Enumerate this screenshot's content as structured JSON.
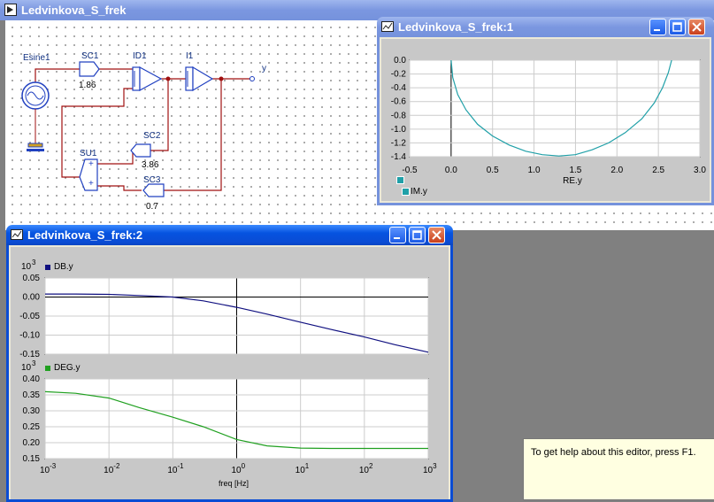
{
  "main_window": {
    "title": "Ledvinkova_S_frek",
    "blocks": {
      "esine": "Esine1",
      "sc1": "SC1",
      "sc1_value": "1.86",
      "id1": "ID1",
      "i1": "I1",
      "output": "y",
      "sc2": "SC2",
      "sc2_value": "3.86",
      "su1": "SU1",
      "sc3": "SC3",
      "sc3_value": "0.7",
      "plus1": "+",
      "plus2": "+"
    }
  },
  "plot_window_1": {
    "title": "Ledvinkova_S_frek:1",
    "legend": "IM.y",
    "xlabel": "RE.y",
    "xticks": [
      "-0.5",
      "0.0",
      "0.5",
      "1.0",
      "1.5",
      "2.0",
      "2.5",
      "3.0"
    ],
    "yticks": [
      "0.0",
      "-0.2",
      "-0.4",
      "-0.6",
      "-0.8",
      "-1.0",
      "-1.2",
      "-1.4"
    ]
  },
  "plot_window_2": {
    "title": "Ledvinkova_S_frek:2",
    "top": {
      "exponent_base": "10",
      "exponent": "3",
      "legend": "DB.y",
      "yticks": [
        "0.05",
        "0.00",
        "-0.05",
        "-0.10",
        "-0.15"
      ]
    },
    "bottom": {
      "exponent_base": "10",
      "exponent": "3",
      "legend": "DEG.y",
      "yticks": [
        "0.40",
        "0.35",
        "0.30",
        "0.25",
        "0.20",
        "0.15"
      ]
    },
    "xlabel": "freq [Hz]",
    "xticks": [
      {
        "base": "10",
        "exp": "-3"
      },
      {
        "base": "10",
        "exp": "-2"
      },
      {
        "base": "10",
        "exp": "-1"
      },
      {
        "base": "10",
        "exp": "0"
      },
      {
        "base": "10",
        "exp": "1"
      },
      {
        "base": "10",
        "exp": "2"
      },
      {
        "base": "10",
        "exp": "3"
      }
    ]
  },
  "help_hint": "To get help about this editor, press F1.",
  "colors": {
    "nyquist": "#20a0a8",
    "db": "#101080",
    "deg": "#20a020",
    "wire": "#a01010",
    "block": "#2040c0"
  },
  "chart_data": [
    {
      "type": "line",
      "title": "",
      "xlabel": "RE.y",
      "ylabel": "",
      "xlim": [
        -0.5,
        3.0
      ],
      "ylim": [
        -1.4,
        0.0
      ],
      "grid": true,
      "legend": "top-left",
      "series": [
        {
          "name": "IM.y",
          "x": [
            0.0,
            0.02,
            0.08,
            0.18,
            0.32,
            0.5,
            0.7,
            0.9,
            1.1,
            1.3,
            1.5,
            1.7,
            1.9,
            2.1,
            2.3,
            2.45,
            2.55,
            2.62,
            2.66
          ],
          "y": [
            0.0,
            -0.25,
            -0.5,
            -0.72,
            -0.93,
            -1.1,
            -1.23,
            -1.32,
            -1.37,
            -1.39,
            -1.37,
            -1.3,
            -1.2,
            -1.05,
            -0.85,
            -0.62,
            -0.4,
            -0.18,
            0.0
          ]
        }
      ]
    },
    {
      "type": "line",
      "title": "",
      "xlabel": "freq [Hz]",
      "ylabel": "",
      "xscale": "log",
      "xlim": [
        0.001,
        1000
      ],
      "ylim": [
        -0.15,
        0.05
      ],
      "grid": true,
      "legend": "top-left",
      "series": [
        {
          "name": "DB.y",
          "x": [
            0.001,
            0.003,
            0.01,
            0.03,
            0.1,
            0.3,
            1,
            3,
            10,
            30,
            100,
            300,
            1000
          ],
          "y": [
            0.008,
            0.008,
            0.007,
            0.004,
            0.0,
            -0.01,
            -0.027,
            -0.045,
            -0.066,
            -0.085,
            -0.105,
            -0.125,
            -0.145
          ]
        }
      ]
    },
    {
      "type": "line",
      "title": "",
      "xlabel": "freq [Hz]",
      "ylabel": "",
      "xscale": "log",
      "xlim": [
        0.001,
        1000
      ],
      "ylim": [
        0.15,
        0.4
      ],
      "grid": true,
      "legend": "top-left",
      "series": [
        {
          "name": "DEG.y",
          "x": [
            0.001,
            0.003,
            0.01,
            0.03,
            0.1,
            0.3,
            1,
            3,
            10,
            30,
            100,
            300,
            1000
          ],
          "y": [
            0.36,
            0.355,
            0.34,
            0.31,
            0.28,
            0.25,
            0.21,
            0.19,
            0.183,
            0.182,
            0.182,
            0.182,
            0.182
          ]
        }
      ]
    }
  ]
}
